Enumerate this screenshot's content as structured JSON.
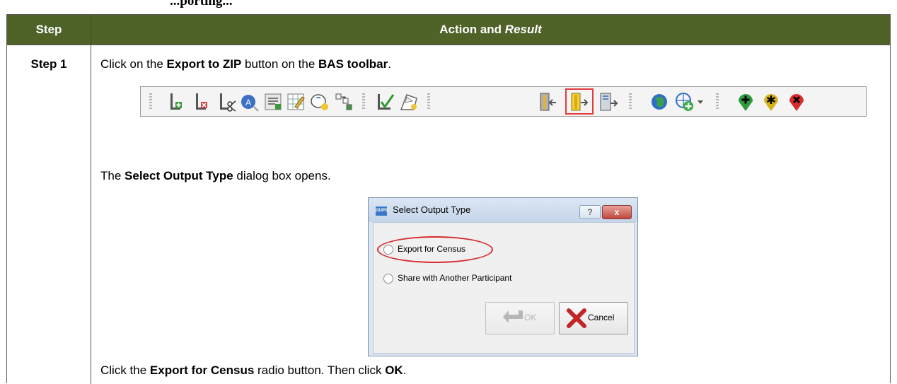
{
  "page": {
    "partial_heading": "...porting..."
  },
  "table": {
    "header": {
      "step": "Step",
      "action": "Action and",
      "result": "Result",
      "accent": "#4f6228"
    },
    "row": {
      "step_label": "Step 1",
      "line1": {
        "pre": "Click on the ",
        "b1": "Export to ZIP",
        "mid": " button on the ",
        "b2": "BAS toolbar",
        "post": "."
      },
      "line2": {
        "pre": "The ",
        "b1": "Select Output Type",
        "post": " dialog box opens."
      },
      "line3": {
        "pre": "Click the ",
        "b1": "Export for Census",
        "mid": " radio button. Then click ",
        "b2": "OK",
        "post": "."
      }
    }
  },
  "toolbar": {
    "icons": [
      "add-line-icon",
      "delete-line-icon",
      "split-line-icon",
      "address-icon",
      "attribute-table-icon",
      "edit-table-icon",
      "review-icon",
      "topology-icon",
      "validate-icon",
      "edit-area-icon",
      "import-zip-icon",
      "export-zip-icon",
      "export-file-icon",
      "globe-icon",
      "add-layer-icon",
      "add-marker-icon",
      "star-marker-icon",
      "remove-marker-icon"
    ],
    "highlighted": "export-zip-icon"
  },
  "dialog": {
    "title": "Select Output Type",
    "help": "?",
    "close": "x",
    "option1": "Export for Census",
    "option2": "Share with Another Participant",
    "ok_label": "OK",
    "cancel_label": "Cancel"
  }
}
